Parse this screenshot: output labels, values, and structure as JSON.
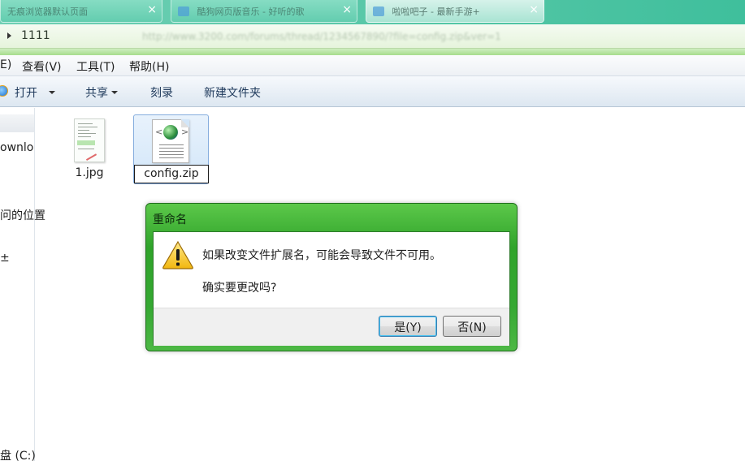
{
  "browser_tabs": [
    {
      "label": "无痕浏览器默认页面"
    },
    {
      "label": "酷狗网页版音乐 - 好听的歌"
    },
    {
      "label": "啦啦吧子 - 最新手游+"
    }
  ],
  "address": {
    "path": "1111",
    "url": "http://www.3200.com/forums/thread/1234567890/?file=config.zip&ver=1"
  },
  "menu": {
    "items": [
      "E)",
      "查看(V)",
      "工具(T)",
      "帮助(H)"
    ]
  },
  "toolbar": {
    "open_label": "打开",
    "share_label": "共享",
    "burn_label": "刻录",
    "new_folder_label": "新建文件夹"
  },
  "nav": {
    "items": [
      "ownlo",
      "问的位置",
      "±",
      "盘 (C:)"
    ]
  },
  "files": [
    {
      "name": "1.jpg"
    },
    {
      "name": "config.zip"
    }
  ],
  "dialog": {
    "title": "重命名",
    "message": "如果改变文件扩展名，可能会导致文件不可用。",
    "question": "确实要更改吗?",
    "yes_label": "是(Y)",
    "no_label": "否(N)"
  },
  "icons": {
    "warning": "warning-icon",
    "open": "internet-explorer-icon",
    "zip": "web-document-icon"
  }
}
